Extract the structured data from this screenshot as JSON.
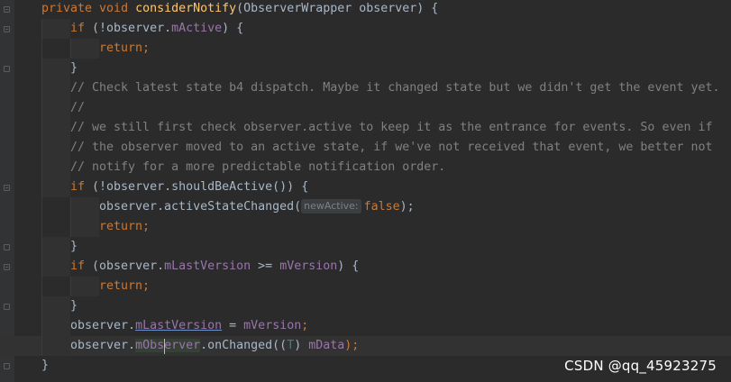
{
  "editor": {
    "lines": [
      {
        "indent": 0,
        "tokens": [
          {
            "t": "private ",
            "c": "kw"
          },
          {
            "t": "void ",
            "c": "kw"
          },
          {
            "t": "considerNotify",
            "c": "fn"
          },
          {
            "t": "(ObserverWrapper observer) {",
            "c": "pl"
          }
        ]
      },
      {
        "indent": 1,
        "tokens": [
          {
            "t": "if ",
            "c": "kw"
          },
          {
            "t": "(!observer.",
            "c": "pl"
          },
          {
            "t": "mActive",
            "c": "fld"
          },
          {
            "t": ") {",
            "c": "pl"
          }
        ]
      },
      {
        "indent": 2,
        "tokens": [
          {
            "t": "return;",
            "c": "kw"
          }
        ]
      },
      {
        "indent": 1,
        "tokens": [
          {
            "t": "}",
            "c": "pl"
          }
        ]
      },
      {
        "indent": 1,
        "tokens": [
          {
            "t": "// Check latest state b4 dispatch. Maybe it changed state but we didn't get the event yet.",
            "c": "cmt"
          }
        ]
      },
      {
        "indent": 1,
        "tokens": [
          {
            "t": "//",
            "c": "cmt"
          }
        ]
      },
      {
        "indent": 1,
        "tokens": [
          {
            "t": "// we still first check observer.active to keep it as the entrance for events. So even if",
            "c": "cmt"
          }
        ]
      },
      {
        "indent": 1,
        "tokens": [
          {
            "t": "// the observer moved to an active state, if we've not received that event, we better not",
            "c": "cmt"
          }
        ]
      },
      {
        "indent": 1,
        "tokens": [
          {
            "t": "// notify for a more predictable notification order.",
            "c": "cmt"
          }
        ]
      },
      {
        "indent": 1,
        "tokens": [
          {
            "t": "if ",
            "c": "kw"
          },
          {
            "t": "(!observer.shouldBeActive()) {",
            "c": "pl"
          }
        ]
      },
      {
        "indent": 2,
        "tokens": [
          {
            "t": "observer.activeStateChanged(",
            "c": "pl"
          },
          {
            "t": "newActive:",
            "c": "hint"
          },
          {
            "t": "false",
            "c": "kw"
          },
          {
            "t": ");",
            "c": "pl"
          }
        ]
      },
      {
        "indent": 2,
        "tokens": [
          {
            "t": "return;",
            "c": "kw"
          }
        ]
      },
      {
        "indent": 1,
        "tokens": [
          {
            "t": "}",
            "c": "pl"
          }
        ]
      },
      {
        "indent": 1,
        "tokens": [
          {
            "t": "if ",
            "c": "kw"
          },
          {
            "t": "(observer.",
            "c": "pl"
          },
          {
            "t": "mLastVersion",
            "c": "fld"
          },
          {
            "t": " >= ",
            "c": "pl"
          },
          {
            "t": "mVersion",
            "c": "fld"
          },
          {
            "t": ") {",
            "c": "pl"
          }
        ]
      },
      {
        "indent": 2,
        "tokens": [
          {
            "t": "return;",
            "c": "kw"
          }
        ]
      },
      {
        "indent": 1,
        "tokens": [
          {
            "t": "}",
            "c": "pl"
          }
        ]
      },
      {
        "indent": 1,
        "tokens": [
          {
            "t": "observer.",
            "c": "pl"
          },
          {
            "t": "mLastVersion",
            "c": "link"
          },
          {
            "t": " = ",
            "c": "pl"
          },
          {
            "t": "mVersion",
            "c": "fld"
          },
          {
            "t": ";",
            "c": "kw"
          }
        ]
      },
      {
        "indent": 1,
        "current": true,
        "tokens": [
          {
            "t": "observer.",
            "c": "pl"
          },
          {
            "t": "mObserver",
            "c": "sel"
          },
          {
            "t": ".onChanged((",
            "c": "pl"
          },
          {
            "t": "T",
            "c": "tp"
          },
          {
            "t": ") ",
            "c": "pl"
          },
          {
            "t": "mData",
            "c": "fld"
          },
          {
            "t": ");",
            "c": "kw"
          }
        ]
      },
      {
        "indent": 0,
        "tokens": [
          {
            "t": "}",
            "c": "pl"
          }
        ]
      }
    ]
  },
  "watermark": "CSDN @qq_45923275"
}
